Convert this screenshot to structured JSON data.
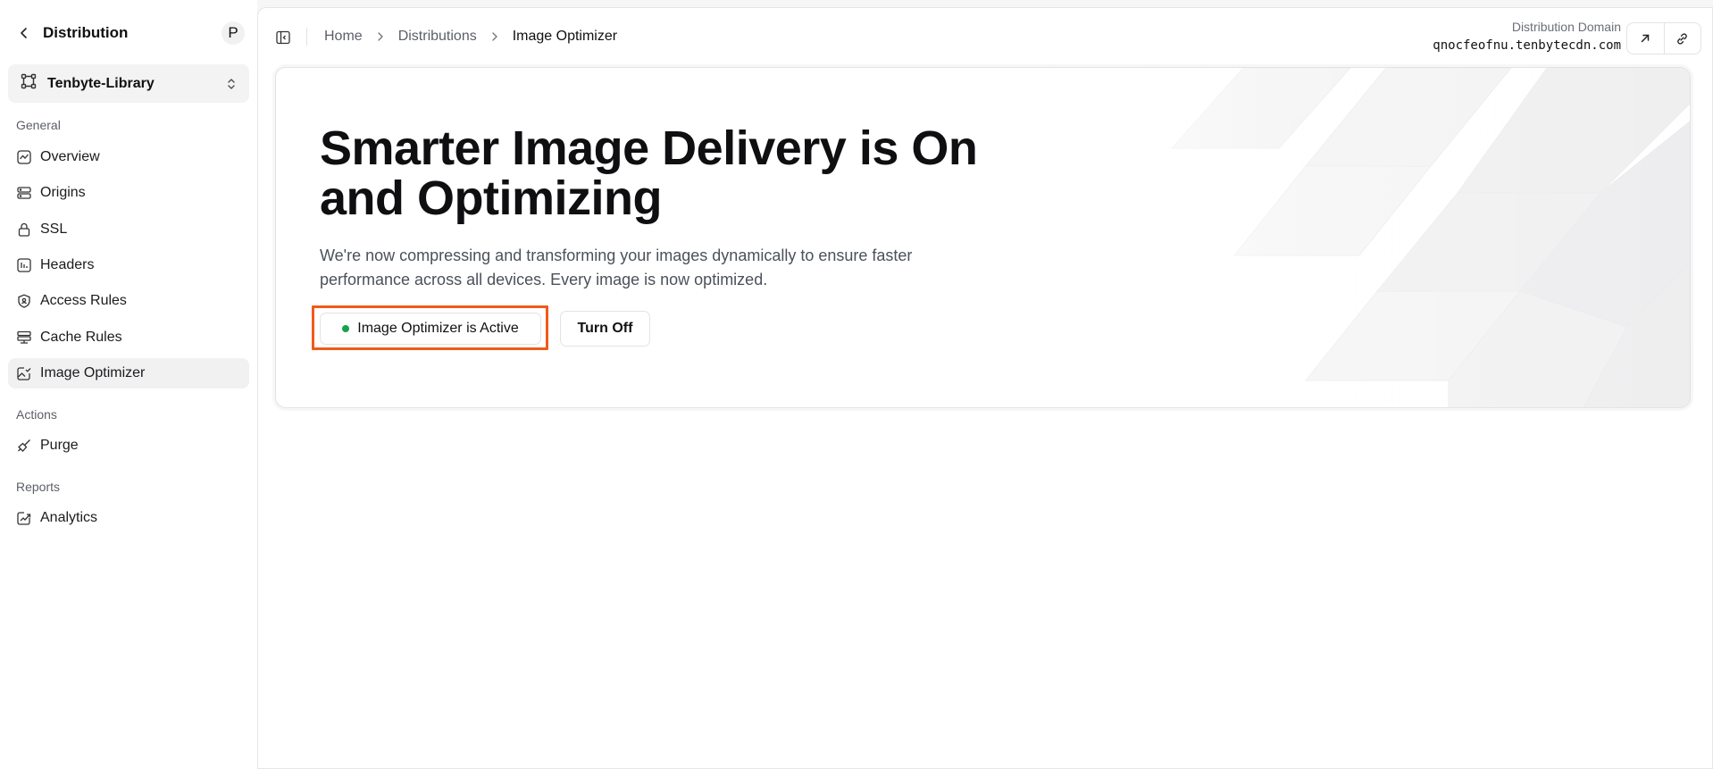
{
  "sidebar": {
    "title": "Distribution",
    "avatar_initial": "P",
    "project": "Tenbyte-Library",
    "sections": {
      "general": "General",
      "actions": "Actions",
      "reports": "Reports"
    },
    "items": {
      "overview": "Overview",
      "origins": "Origins",
      "ssl": "SSL",
      "headers": "Headers",
      "access_rules": "Access Rules",
      "cache_rules": "Cache Rules",
      "image_optimizer": "Image Optimizer",
      "purge": "Purge",
      "analytics": "Analytics"
    },
    "active_item": "Image Optimizer"
  },
  "header": {
    "breadcrumb": [
      "Home",
      "Distributions",
      "Image Optimizer"
    ],
    "domain_label": "Distribution Domain",
    "domain_value": "qnocfeofnu.tenbytecdn.com"
  },
  "hero": {
    "title": "Smarter Image Delivery is On and Optimizing",
    "description": "We're now compressing and transforming your images dynamically to ensure faster performance across all devices. Every image is now optimized.",
    "status_label": "Image Optimizer is Active",
    "turn_off_label": "Turn Off"
  },
  "colors": {
    "status_active": "#16a34a",
    "highlight": "#f05a1a"
  }
}
